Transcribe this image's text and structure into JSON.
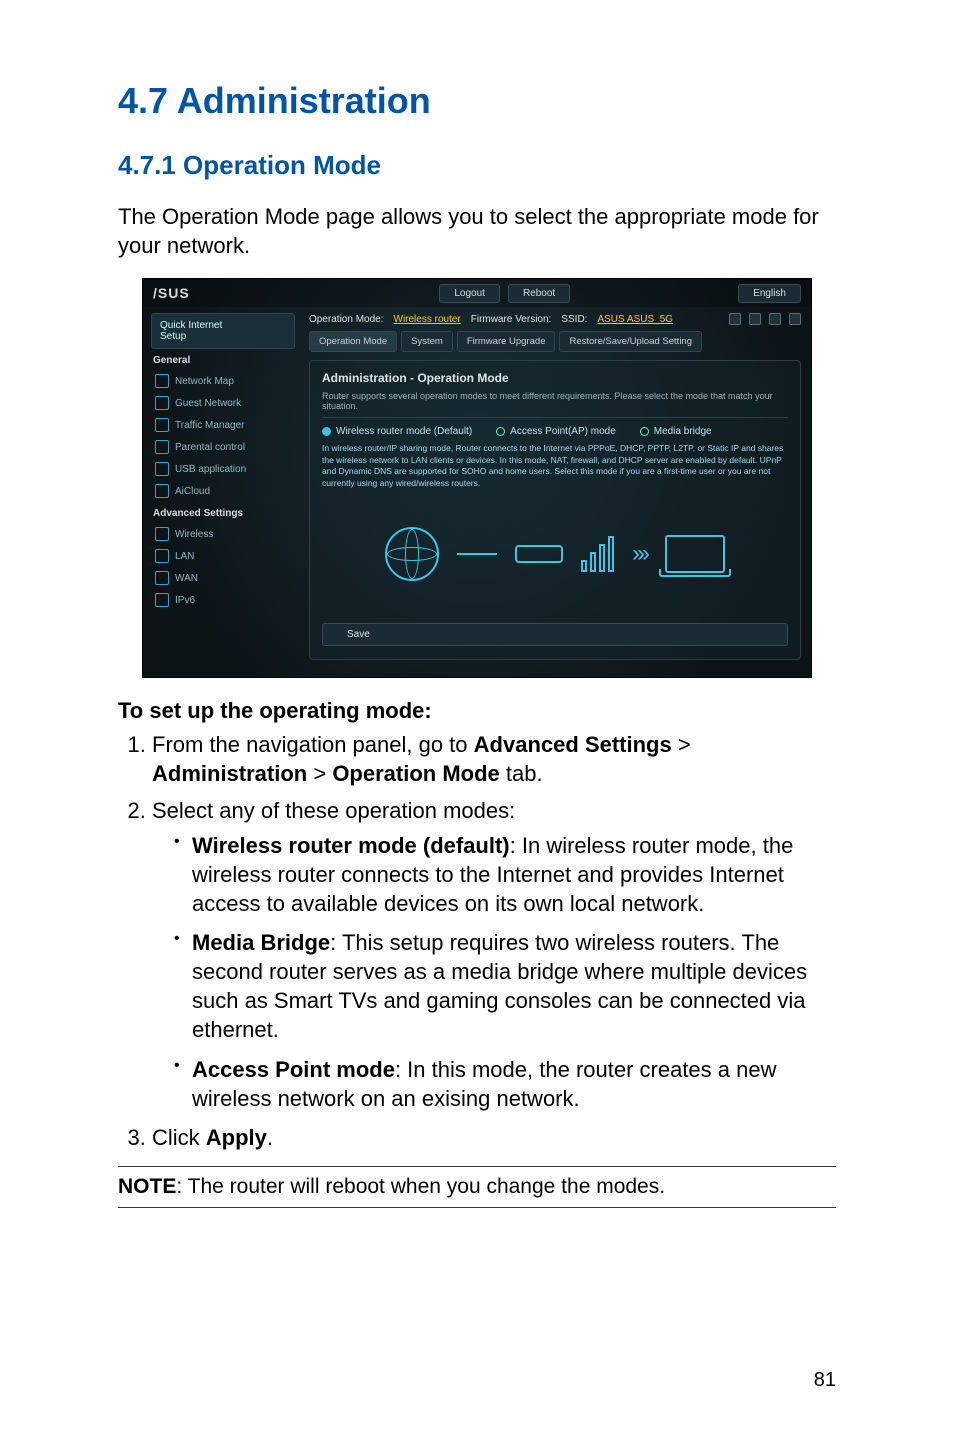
{
  "page": {
    "h1": "4.7   Administration",
    "h2": "4.7.1 Operation Mode",
    "intro": "The Operation Mode page allows you to select the appropriate mode for your network.",
    "number": "81"
  },
  "screenshot": {
    "logo": "/SUS",
    "btn_logout": "Logout",
    "btn_reboot": "Reboot",
    "btn_lang": "English",
    "status_opmode_label": "Operation Mode:",
    "status_opmode_value": "Wireless router",
    "status_fw_label": "Firmware Version:",
    "status_ssid_label": "SSID:",
    "status_ssid_value": "ASUS  ASUS_5G",
    "qis_line1": "Quick Internet",
    "qis_line2": "Setup",
    "sec_general": "General",
    "nav": {
      "network_map": "Network Map",
      "guest_network": "Guest Network",
      "traffic_manager": "Traffic Manager",
      "parental_control": "Parental control",
      "usb_app": "USB application",
      "aicloud": "AiCloud"
    },
    "sec_advanced": "Advanced Settings",
    "adv": {
      "wireless": "Wireless",
      "lan": "LAN",
      "wan": "WAN",
      "ipv6": "IPv6"
    },
    "tabs": {
      "opmode": "Operation Mode",
      "system": "System",
      "fw": "Firmware Upgrade",
      "restore": "Restore/Save/Upload Setting"
    },
    "panel": {
      "title": "Administration - Operation Mode",
      "desc": "Router supports several operation modes to meet different requirements. Please select the mode that match your situation.",
      "radio_wr": "Wireless router mode (Default)",
      "radio_ap": "Access Point(AP) mode",
      "radio_mb": "Media bridge",
      "modetext": "In wireless router/IP sharing mode, Router connects to the Internet via PPPoE, DHCP, PPTP, L2TP, or Static IP and shares the wireless network to LAN clients or devices. In this mode, NAT, firewall, and DHCP server are enabled by default. UPnP and Dynamic DNS are supported for SOHO and home users. Select this mode if you are a first-time user or you are not currently using any wired/wireless routers.",
      "save": "Save"
    }
  },
  "instructions": {
    "heading": "To set up the operating mode:",
    "step1_pre": "From the navigation panel, go to ",
    "step1_b1": "Advanced Settings",
    "step1_gt1": " > ",
    "step1_b2": "Administration",
    "step1_gt2": " > ",
    "step1_b3": "Operation Mode",
    "step1_post": " tab.",
    "step2": "Select any of these operation modes:",
    "bullet1_b": "Wireless router mode (default)",
    "bullet1_t": ": In wireless router mode, the wireless router connects to the Internet and provides Internet access to available devices on its own local network.",
    "bullet2_b": "Media Bridge",
    "bullet2_t": ": This setup requires two wireless routers. The second router serves as a media bridge where multiple devices such as Smart TVs and gaming consoles can be connected via ethernet.",
    "bullet3_b": "Access Point mode",
    "bullet3_t": ": In this mode, the router creates a new wireless network on an exising network.",
    "step3_pre": "Click ",
    "step3_b": "Apply",
    "step3_post": "."
  },
  "note": {
    "label": "NOTE",
    "text": ":  The router will reboot when you change the modes."
  }
}
